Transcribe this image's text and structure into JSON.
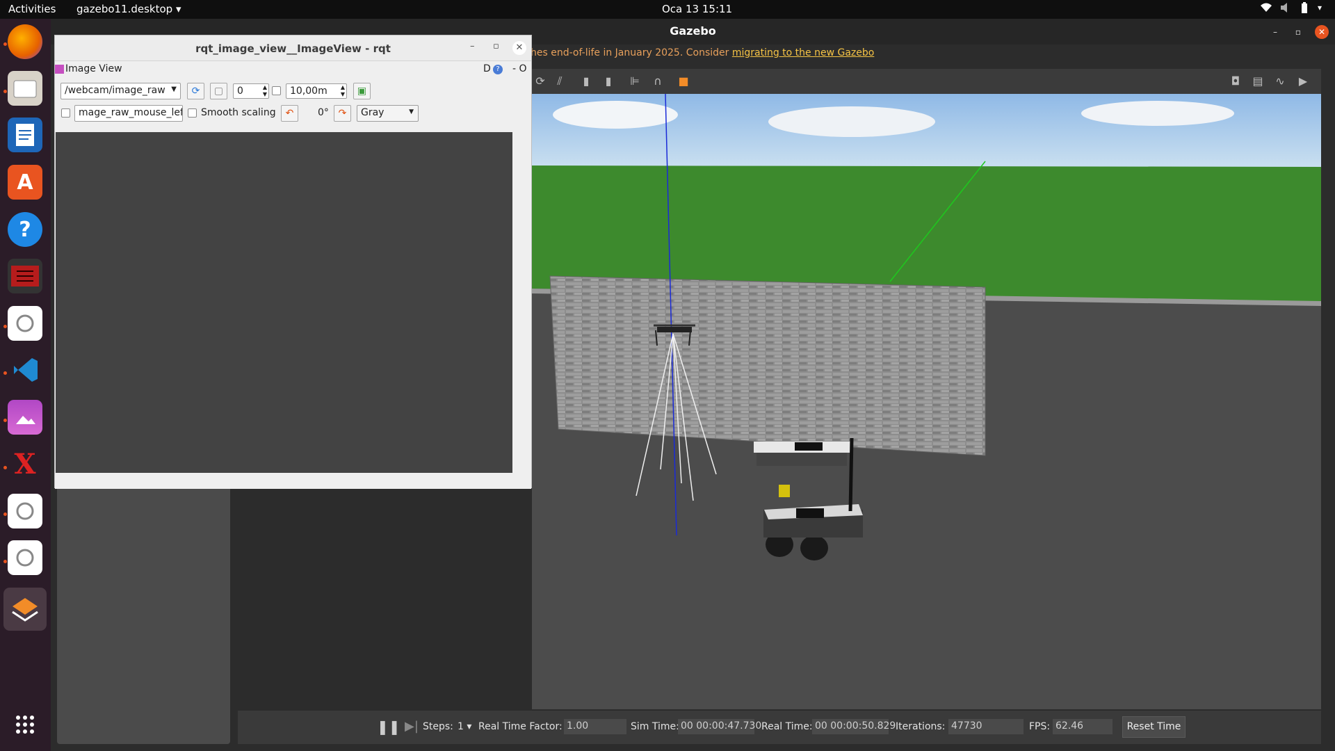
{
  "topbar": {
    "activities": "Activities",
    "app_menu": "gazebo11.desktop",
    "clock": "Oca 13  15:11"
  },
  "gazebo": {
    "title": "Gazebo",
    "deprecation_text": "hes end-of-life in January 2025. Consider ",
    "deprecation_link": "migrating to the new Gazebo",
    "bottom": {
      "steps_label": "Steps:",
      "steps_value": "1",
      "rtf_label": "Real Time Factor:",
      "rtf_value": "1.00",
      "sim_time_label": "Sim Time:",
      "sim_time_value": "00 00:00:47.730",
      "real_time_label": "Real Time:",
      "real_time_value": "00 00:00:50.829",
      "iterations_label": "Iterations:",
      "iterations_value": "47730",
      "fps_label": "FPS:",
      "fps_value": "62.46",
      "reset_label": "Reset Time"
    }
  },
  "rqt": {
    "title": "rqt_image_view__ImageView - rqt",
    "plugin_title": "Image View",
    "plugin_right": "D",
    "plugin_dash": "- O",
    "topic": "/webcam/image_raw",
    "spin_value": "0",
    "max_value": "10,00m",
    "mouse_topic": "mage_raw_mouse_left",
    "smooth_label": "Smooth scaling",
    "rotation": "0°",
    "color_scheme": "Gray"
  },
  "colors": {
    "dock_bg": "#2b1c28",
    "accent": "#e95420",
    "link": "#f6c445"
  },
  "icons": [
    "firefox-icon",
    "files-icon",
    "writer-icon",
    "software-icon",
    "help-icon",
    "terminal-app-icon",
    "settings-icon",
    "vscode-icon",
    "image-viewer-icon",
    "latex-icon",
    "settings-icon-2",
    "settings-icon-3",
    "gazebo-icon",
    "app-grid-icon"
  ]
}
